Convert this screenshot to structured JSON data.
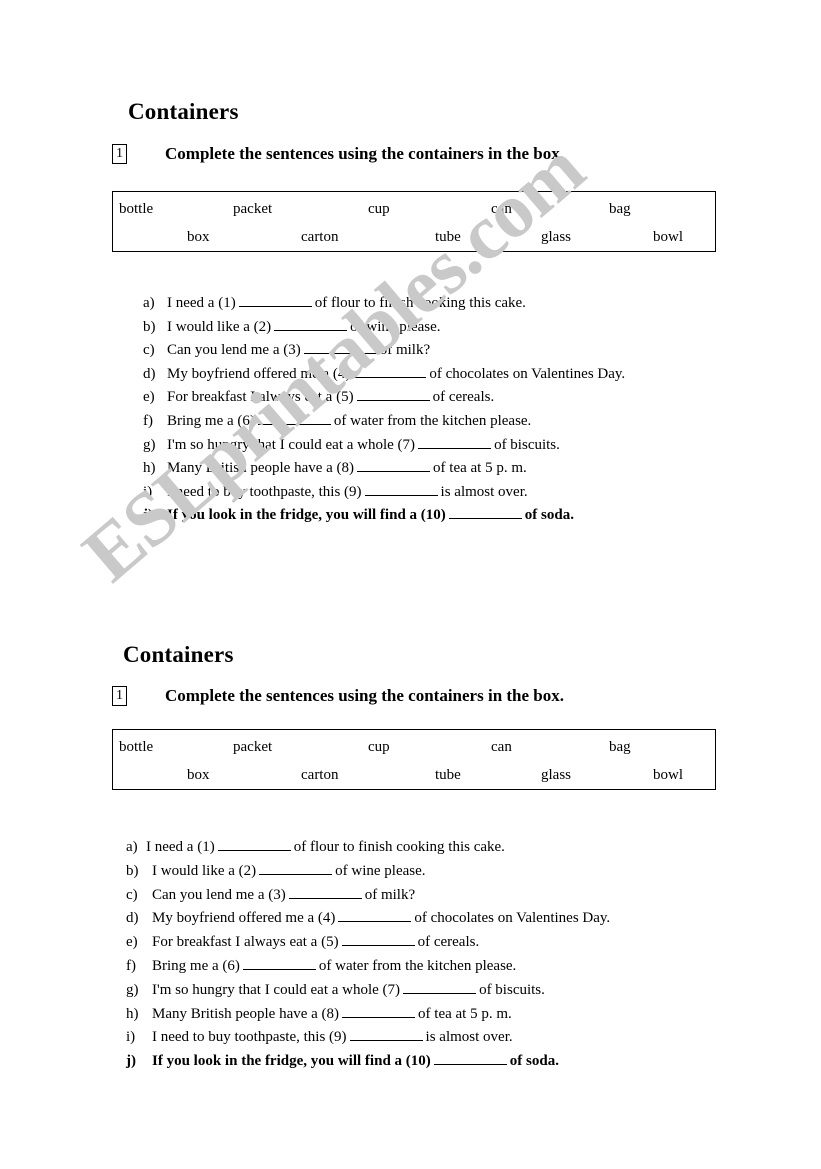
{
  "watermark": {
    "text": "ESLprintables.com",
    "color": "#c9c9c9"
  },
  "worksheet": {
    "title": "Containers",
    "exercise_number": "1",
    "instruction": "Complete the sentences using the containers in the box.",
    "word_bank": {
      "row1": [
        "bottle",
        "packet",
        "cup",
        "can",
        "bag"
      ],
      "row2": [
        "box",
        "carton",
        "tube",
        "glass",
        "bowl"
      ]
    },
    "sentences": [
      {
        "marker": "a)",
        "pre": "I need a (1)",
        "post": "of flour to finish cooking this cake.",
        "bold": false
      },
      {
        "marker": "b)",
        "pre": "I would like a (2)",
        "post": "of wine please.",
        "bold": false
      },
      {
        "marker": "c)",
        "pre": "Can you lend me a (3)",
        "post": "of milk?",
        "bold": false
      },
      {
        "marker": "d)",
        "pre": "My boyfriend offered me a (4)",
        "post": "of chocolates on Valentines Day.",
        "bold": false
      },
      {
        "marker": "e)",
        "pre": "For breakfast I always eat a (5)",
        "post": "of cereals.",
        "bold": false
      },
      {
        "marker": "f)",
        "pre": "Bring me a (6)",
        "post": "of water from the kitchen please.",
        "bold": false
      },
      {
        "marker": "g)",
        "pre": "I'm so hungry that I could eat a whole (7)",
        "post": "of biscuits.",
        "bold": false
      },
      {
        "marker": "h)",
        "pre": "Many British people have a (8)",
        "post": "of tea at 5 p. m.",
        "bold": false
      },
      {
        "marker": "i)",
        "pre": "I need to buy toothpaste, this (9)",
        "post": "is almost over.",
        "bold": false
      },
      {
        "marker": "j)",
        "pre": "If you look in the fridge, you will find a (10)",
        "post": "of soda.",
        "bold": true
      }
    ]
  }
}
